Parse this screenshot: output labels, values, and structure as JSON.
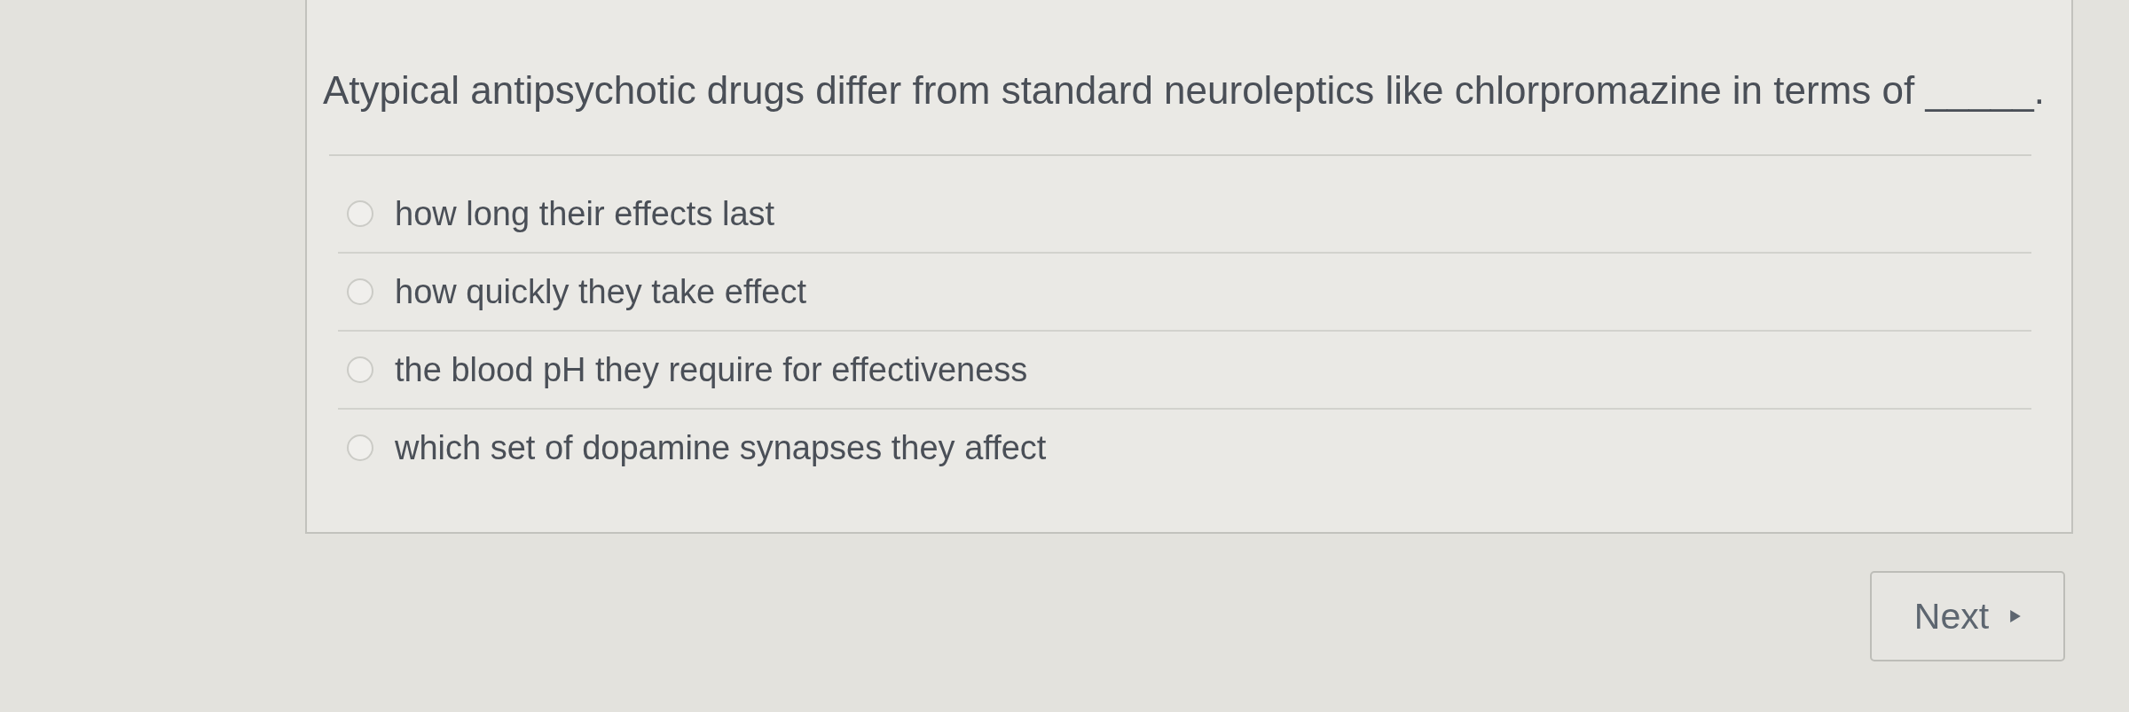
{
  "question": {
    "text": "Atypical antipsychotic drugs differ from standard neuroleptics like chlorpromazine in terms of _____."
  },
  "options": [
    {
      "label": "how long their effects last",
      "selected": false
    },
    {
      "label": "how quickly they take effect",
      "selected": false
    },
    {
      "label": "the blood pH they require for effectiveness",
      "selected": false
    },
    {
      "label": "which set of dopamine synapses they affect",
      "selected": false
    }
  ],
  "next_button": {
    "label": "Next"
  }
}
